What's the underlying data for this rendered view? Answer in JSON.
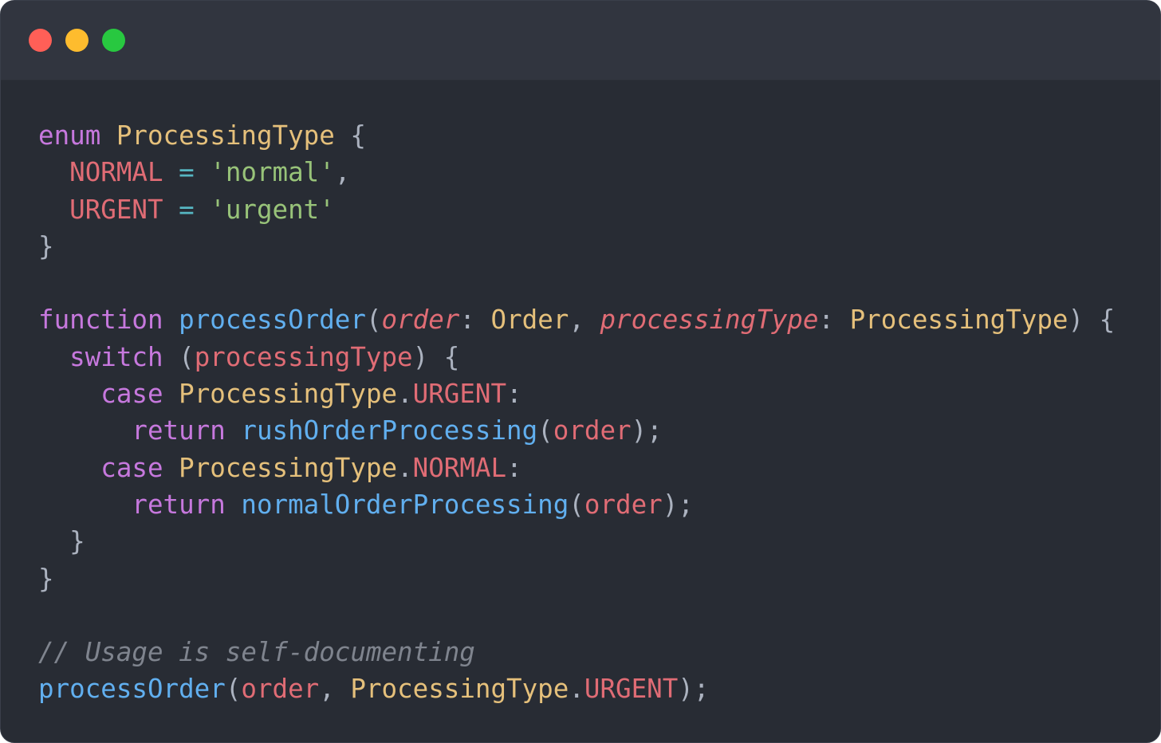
{
  "colors": {
    "window_bg": "#282c34",
    "titlebar_bg": "#31353f",
    "close": "#ff5f57",
    "minimize": "#febc2e",
    "maximize": "#28c840",
    "keyword": "#c678dd",
    "type": "#e5c07b",
    "property": "#e06c75",
    "string": "#98c379",
    "function": "#61afef",
    "operator": "#56b6c2",
    "punctuation": "#abb2bf",
    "comment": "#7f848e"
  },
  "window_controls": [
    {
      "name": "close-button",
      "color": "#ff5f57"
    },
    {
      "name": "minimize-button",
      "color": "#febc2e"
    },
    {
      "name": "maximize-button",
      "color": "#28c840"
    }
  ],
  "code": {
    "lines": [
      [
        {
          "t": "enum",
          "k": "keyword"
        },
        {
          "t": " ",
          "k": "punctuation"
        },
        {
          "t": "ProcessingType",
          "k": "type"
        },
        {
          "t": " {",
          "k": "punctuation"
        }
      ],
      [
        {
          "t": "  ",
          "k": "punctuation"
        },
        {
          "t": "NORMAL",
          "k": "property"
        },
        {
          "t": " = ",
          "k": "operator"
        },
        {
          "t": "'normal'",
          "k": "string"
        },
        {
          "t": ",",
          "k": "punctuation"
        }
      ],
      [
        {
          "t": "  ",
          "k": "punctuation"
        },
        {
          "t": "URGENT",
          "k": "property"
        },
        {
          "t": " = ",
          "k": "operator"
        },
        {
          "t": "'urgent'",
          "k": "string"
        }
      ],
      [
        {
          "t": "}",
          "k": "punctuation"
        }
      ],
      [],
      [
        {
          "t": "function",
          "k": "keyword"
        },
        {
          "t": " ",
          "k": "punctuation"
        },
        {
          "t": "processOrder",
          "k": "function"
        },
        {
          "t": "(",
          "k": "punctuation"
        },
        {
          "t": "order",
          "k": "property",
          "i": true
        },
        {
          "t": ": ",
          "k": "punctuation"
        },
        {
          "t": "Order",
          "k": "type"
        },
        {
          "t": ", ",
          "k": "punctuation"
        },
        {
          "t": "processingType",
          "k": "property",
          "i": true
        },
        {
          "t": ": ",
          "k": "punctuation"
        },
        {
          "t": "ProcessingType",
          "k": "type"
        },
        {
          "t": ") {",
          "k": "punctuation"
        }
      ],
      [
        {
          "t": "  ",
          "k": "punctuation"
        },
        {
          "t": "switch",
          "k": "keyword"
        },
        {
          "t": " (",
          "k": "punctuation"
        },
        {
          "t": "processingType",
          "k": "property"
        },
        {
          "t": ") {",
          "k": "punctuation"
        }
      ],
      [
        {
          "t": "    ",
          "k": "punctuation"
        },
        {
          "t": "case",
          "k": "keyword"
        },
        {
          "t": " ",
          "k": "punctuation"
        },
        {
          "t": "ProcessingType",
          "k": "type"
        },
        {
          "t": ".",
          "k": "punctuation"
        },
        {
          "t": "URGENT",
          "k": "property"
        },
        {
          "t": ":",
          "k": "punctuation"
        }
      ],
      [
        {
          "t": "      ",
          "k": "punctuation"
        },
        {
          "t": "return",
          "k": "keyword"
        },
        {
          "t": " ",
          "k": "punctuation"
        },
        {
          "t": "rushOrderProcessing",
          "k": "function"
        },
        {
          "t": "(",
          "k": "punctuation"
        },
        {
          "t": "order",
          "k": "property"
        },
        {
          "t": ");",
          "k": "punctuation"
        }
      ],
      [
        {
          "t": "    ",
          "k": "punctuation"
        },
        {
          "t": "case",
          "k": "keyword"
        },
        {
          "t": " ",
          "k": "punctuation"
        },
        {
          "t": "ProcessingType",
          "k": "type"
        },
        {
          "t": ".",
          "k": "punctuation"
        },
        {
          "t": "NORMAL",
          "k": "property"
        },
        {
          "t": ":",
          "k": "punctuation"
        }
      ],
      [
        {
          "t": "      ",
          "k": "punctuation"
        },
        {
          "t": "return",
          "k": "keyword"
        },
        {
          "t": " ",
          "k": "punctuation"
        },
        {
          "t": "normalOrderProcessing",
          "k": "function"
        },
        {
          "t": "(",
          "k": "punctuation"
        },
        {
          "t": "order",
          "k": "property"
        },
        {
          "t": ");",
          "k": "punctuation"
        }
      ],
      [
        {
          "t": "  }",
          "k": "punctuation"
        }
      ],
      [
        {
          "t": "}",
          "k": "punctuation"
        }
      ],
      [],
      [
        {
          "t": "// Usage is self-documenting",
          "k": "comment",
          "i": true
        }
      ],
      [
        {
          "t": "processOrder",
          "k": "function"
        },
        {
          "t": "(",
          "k": "punctuation"
        },
        {
          "t": "order",
          "k": "property"
        },
        {
          "t": ", ",
          "k": "punctuation"
        },
        {
          "t": "ProcessingType",
          "k": "type"
        },
        {
          "t": ".",
          "k": "punctuation"
        },
        {
          "t": "URGENT",
          "k": "property"
        },
        {
          "t": ");",
          "k": "punctuation"
        }
      ]
    ]
  }
}
